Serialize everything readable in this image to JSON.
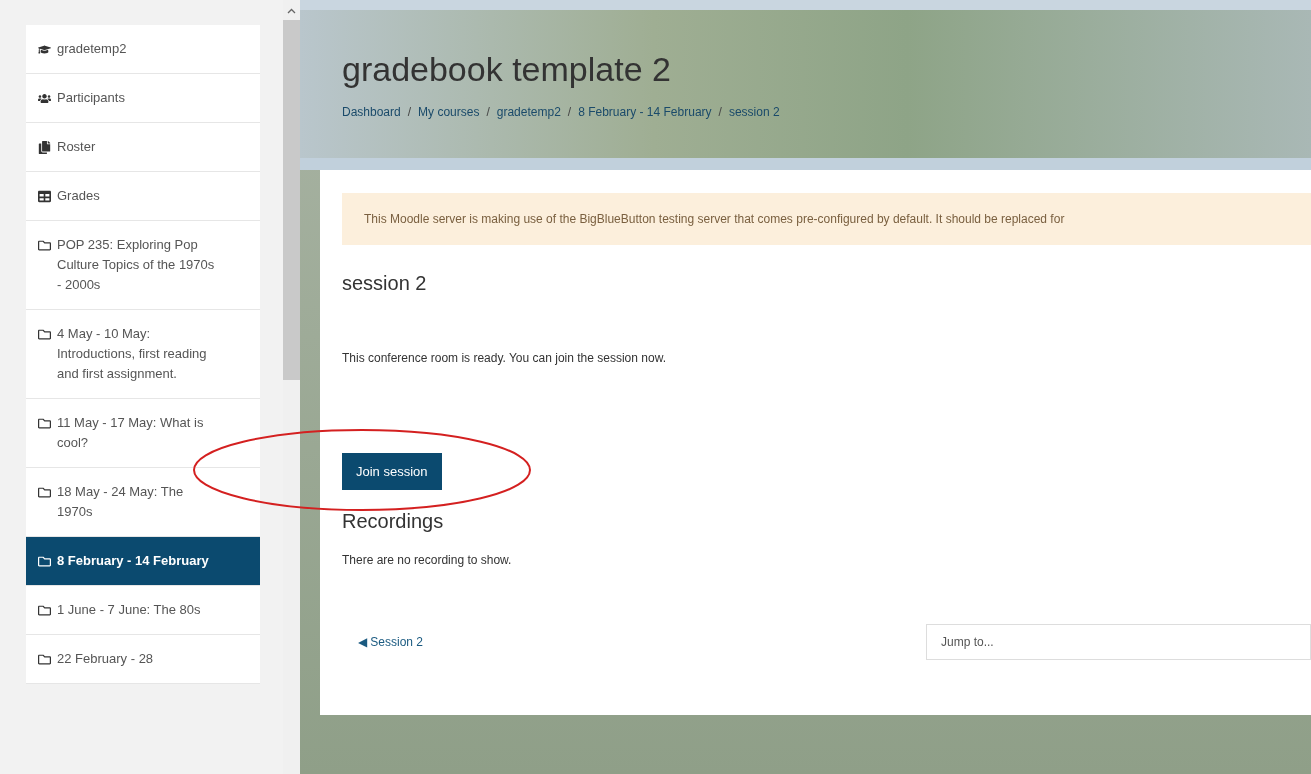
{
  "sidebar": {
    "items": [
      {
        "label": "gradetemp2",
        "kind": "course",
        "selected": false
      },
      {
        "label": "Participants",
        "kind": "participants",
        "selected": false
      },
      {
        "label": "Roster",
        "kind": "roster",
        "selected": false
      },
      {
        "label": "Grades",
        "kind": "grades",
        "selected": false
      },
      {
        "label": "POP 235: Exploring Pop Culture Topics of the 1970s - 2000s",
        "kind": "section",
        "selected": false
      },
      {
        "label": "4 May - 10 May: Introductions, first reading and first assignment.",
        "kind": "section",
        "selected": false
      },
      {
        "label": "11 May - 17 May: What is cool?",
        "kind": "section",
        "selected": false
      },
      {
        "label": "18 May - 24 May: The 1970s",
        "kind": "section",
        "selected": false
      },
      {
        "label": "8 February - 14 February",
        "kind": "section",
        "selected": true
      },
      {
        "label": "1 June - 7 June: The 80s",
        "kind": "section",
        "selected": false
      },
      {
        "label": "22 February - 28",
        "kind": "section",
        "selected": false
      }
    ]
  },
  "header": {
    "title": "gradebook template 2",
    "breadcrumb": {
      "separator": "/",
      "items": [
        "Dashboard",
        "My courses",
        "gradetemp2",
        "8 February - 14 February",
        "session 2"
      ]
    }
  },
  "alert": "This Moodle server is making use of the BigBlueButton testing server that comes pre-configured by default. It should be replaced for",
  "session": {
    "title": "session 2",
    "status": "This conference room is ready. You can join the session now.",
    "join_button": "Join session"
  },
  "recordings": {
    "title": "Recordings",
    "empty_text": "There are no recording to show."
  },
  "footer": {
    "prev_link": "◀ Session 2",
    "jump": {
      "placeholder": "Jump to..."
    }
  }
}
